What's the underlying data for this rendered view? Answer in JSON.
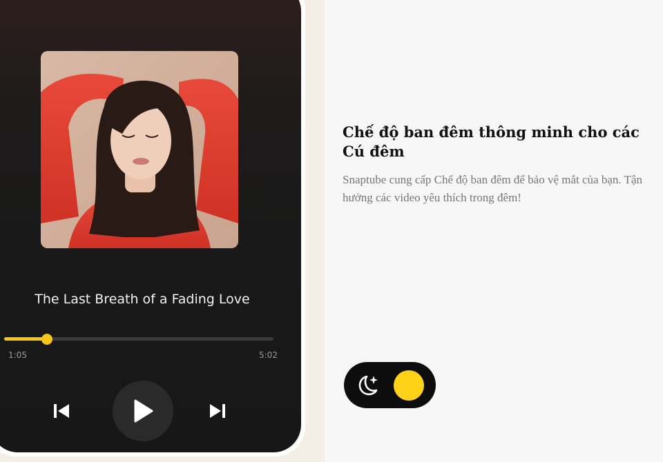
{
  "player": {
    "song_title": "The Last Breath of a Fading Love",
    "current_time": "1:05",
    "total_time": "5:02",
    "progress_fraction": 0.16,
    "accent_color": "#f5c518",
    "album_art_icon": "album-art-photo",
    "controls": {
      "previous_icon": "skip-previous-icon",
      "play_icon": "play-icon",
      "next_icon": "skip-next-icon"
    }
  },
  "feature": {
    "title": "Chế độ ban đêm thông minh cho các Cú đêm",
    "description": "Snaptube cung cấp Chế độ ban đêm để bảo vệ mắt của bạn. Tận hưởng các video yêu thích trong đêm!"
  },
  "night_mode_toggle": {
    "icon": "moon-star-icon",
    "state": "on",
    "knob_color": "#ffd21a"
  }
}
